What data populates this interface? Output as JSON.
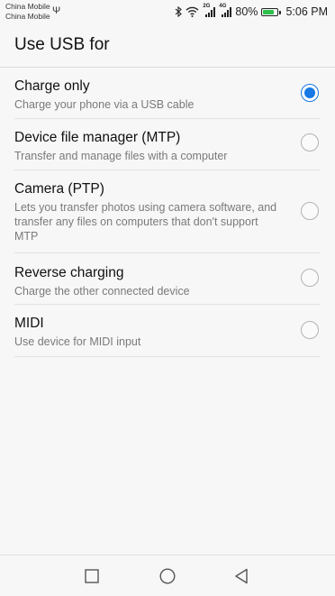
{
  "status_bar": {
    "carrier_1": "China Mobile",
    "carrier_2": "China Mobile",
    "usb_symbol": "Ψ",
    "network_tag_1": "2G",
    "network_tag_2": "4G",
    "battery_percent": "80%",
    "battery_level": 0.8,
    "time": "5:06 PM",
    "icons": [
      "usb-icon",
      "bluetooth-icon",
      "wifi-icon",
      "signal-icon",
      "battery-icon"
    ]
  },
  "header": {
    "title": "Use USB for"
  },
  "options": [
    {
      "title": "Charge only",
      "description": "Charge your phone via a USB cable",
      "selected": true
    },
    {
      "title": "Device file manager (MTP)",
      "description": "Transfer and manage files with a computer",
      "selected": false
    },
    {
      "title": "Camera (PTP)",
      "description": "Lets you transfer photos using camera software, and transfer any files on computers that don't support MTP",
      "selected": false
    },
    {
      "title": "Reverse charging",
      "description": "Charge the other connected device",
      "selected": false
    },
    {
      "title": "MIDI",
      "description": "Use device for MIDI input",
      "selected": false
    }
  ],
  "nav_bar": {
    "icons": [
      "recent-apps-icon",
      "home-icon",
      "back-icon"
    ]
  },
  "colors": {
    "accent": "#1778e6",
    "battery": "#2ec04a",
    "background": "#f7f7f7"
  }
}
